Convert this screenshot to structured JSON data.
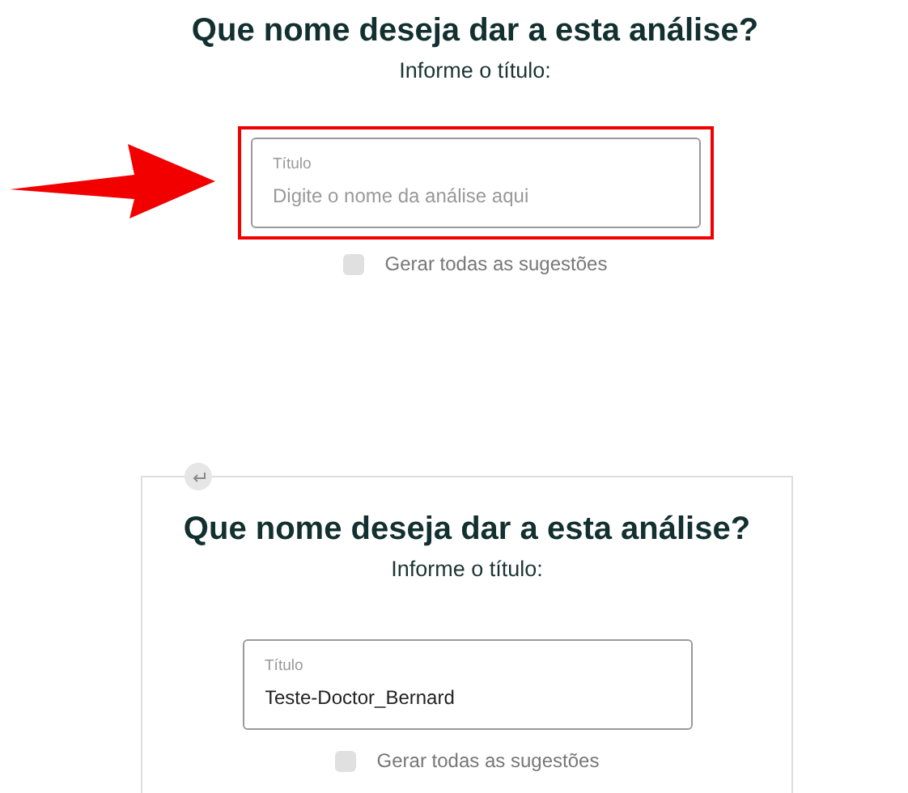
{
  "sections": [
    {
      "card": false,
      "highlighted": true,
      "title": "Que nome deseja dar a esta análise?",
      "subtitle": "Informe o título:",
      "field": {
        "label": "Título",
        "placeholder": "Digite o nome da análise aqui"
      },
      "checkbox": {
        "label": "Gerar todas as sugestões",
        "checked": false
      }
    },
    {
      "card": true,
      "highlighted": false,
      "title": "Que nome deseja dar a esta análise?",
      "subtitle": "Informe o título:",
      "field": {
        "label": "Título",
        "value": "Teste-Doctor_Bernard"
      },
      "checkbox": {
        "label": "Gerar todas as sugestões",
        "checked": false
      }
    }
  ]
}
